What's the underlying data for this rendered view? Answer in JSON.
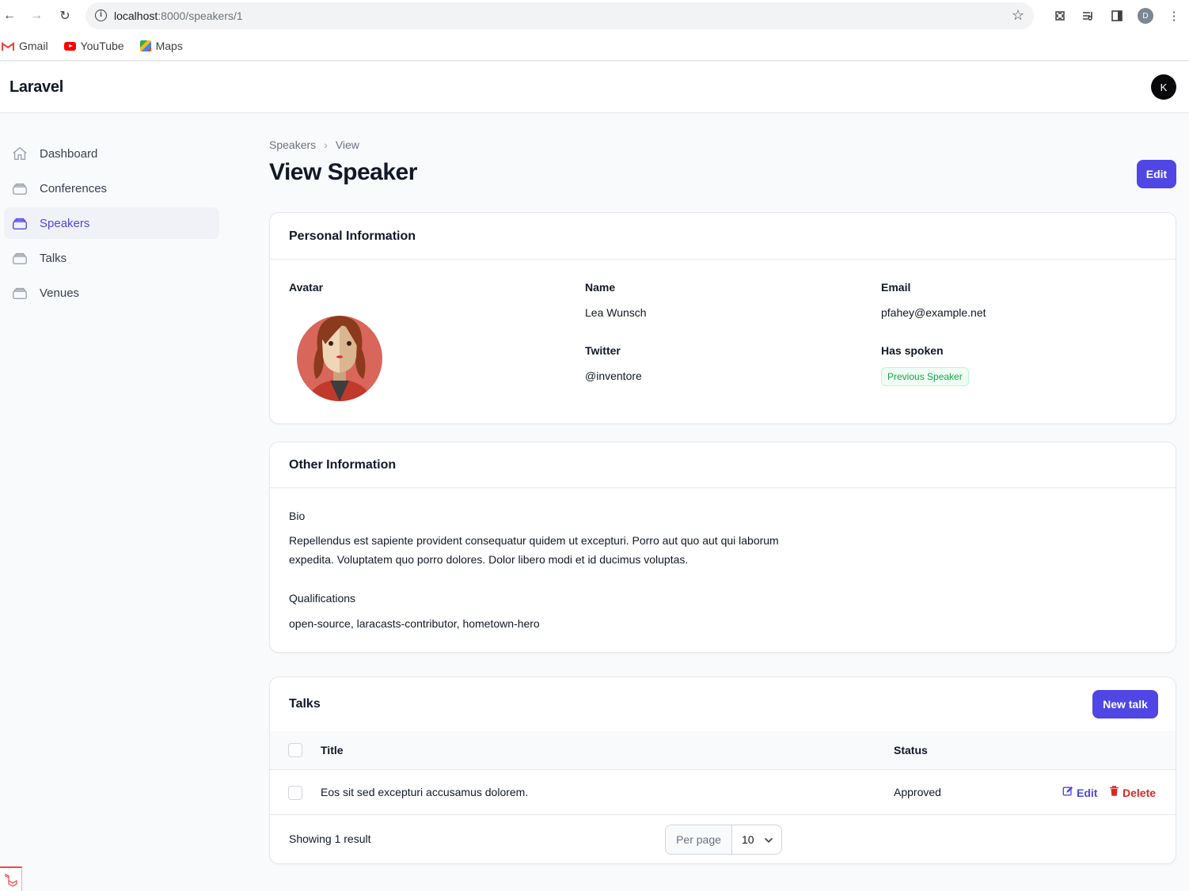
{
  "browser": {
    "url_host": "localhost",
    "url_path": ":8000/speakers/1",
    "profile_initial": "D"
  },
  "bookmarks": [
    {
      "label": "Gmail",
      "icon": "gmail-icon"
    },
    {
      "label": "YouTube",
      "icon": "youtube-icon"
    },
    {
      "label": "Maps",
      "icon": "maps-icon"
    }
  ],
  "app": {
    "brand": "Laravel",
    "user_initial": "K",
    "accent_color": "#4f46e5"
  },
  "sidebar": {
    "items": [
      {
        "label": "Dashboard",
        "icon": "home-icon",
        "active": false
      },
      {
        "label": "Conferences",
        "icon": "rectangle-stack-icon",
        "active": false
      },
      {
        "label": "Speakers",
        "icon": "rectangle-stack-icon",
        "active": true
      },
      {
        "label": "Talks",
        "icon": "rectangle-stack-icon",
        "active": false
      },
      {
        "label": "Venues",
        "icon": "rectangle-stack-icon",
        "active": false
      }
    ]
  },
  "header": {
    "breadcrumb": [
      "Speakers",
      "View"
    ],
    "title": "View Speaker",
    "edit_label": "Edit"
  },
  "personal": {
    "section_title": "Personal Information",
    "avatar_label": "Avatar",
    "name_label": "Name",
    "name_value": "Lea Wunsch",
    "email_label": "Email",
    "email_value": "pfahey@example.net",
    "twitter_label": "Twitter",
    "twitter_value": "@inventore",
    "has_spoken_label": "Has spoken",
    "has_spoken_badge": "Previous Speaker"
  },
  "other": {
    "section_title": "Other Information",
    "bio_label": "Bio",
    "bio_value": "Repellendus est sapiente provident consequatur quidem ut excepturi. Porro aut quo aut qui laborum expedita. Voluptatem quo porro dolores. Dolor libero modi et id ducimus voluptas.",
    "qualifications_label": "Qualifications",
    "qualifications_value": "open-source, laracasts-contributor, hometown-hero"
  },
  "talks": {
    "section_title": "Talks",
    "new_label": "New talk",
    "columns": {
      "title": "Title",
      "status": "Status"
    },
    "rows": [
      {
        "title": "Eos sit sed excepturi accusamus dolorem.",
        "status": "Approved",
        "edit_label": "Edit",
        "delete_label": "Delete"
      }
    ],
    "summary": "Showing 1 result",
    "per_page_label": "Per page",
    "per_page_value": "10"
  }
}
